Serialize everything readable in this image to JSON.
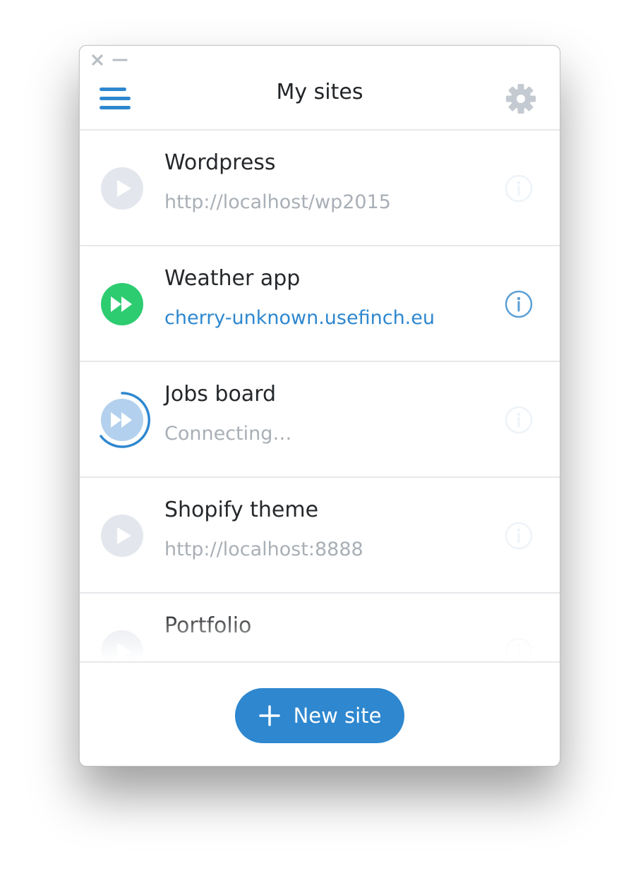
{
  "window": {
    "title": "My sites",
    "controls": {
      "close_icon": "close-icon",
      "minimize_icon": "minimize-icon"
    }
  },
  "header": {
    "menu_icon": "hamburger-menu-icon",
    "settings_icon": "gear-icon"
  },
  "sites": [
    {
      "name": "Wordpress",
      "url": "http://localhost/wp2015",
      "status": "stopped"
    },
    {
      "name": "Weather app",
      "url": "cherry-unknown.usefinch.eu",
      "status": "running"
    },
    {
      "name": "Jobs board",
      "url": "Connecting…",
      "status": "connecting"
    },
    {
      "name": "Shopify theme",
      "url": "http://localhost:8888",
      "status": "stopped"
    },
    {
      "name": "Portfolio",
      "url": "",
      "status": "stopped"
    }
  ],
  "footer": {
    "new_site_label": "New site"
  },
  "colors": {
    "accent": "#2e87cf",
    "running": "#2ecc71",
    "stopped": "#e3e7ed",
    "connecting": "#b3d1ee",
    "muted_text": "#a9afb6"
  }
}
